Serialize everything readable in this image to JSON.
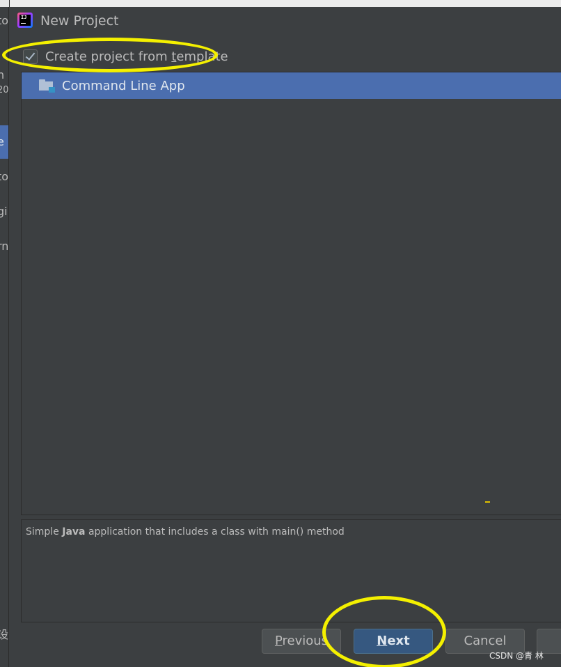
{
  "background_window": {
    "fragments": [
      "to",
      "n",
      "20",
      "e",
      "to",
      "gi",
      "rn",
      "设"
    ]
  },
  "dialog": {
    "title": "New Project",
    "app_icon": "intellij-idea-icon",
    "template_checkbox": {
      "label_pre": "Create project from ",
      "label_mnemonic": "t",
      "label_post": "emplate",
      "checked": true
    },
    "templates": [
      {
        "label": "Command Line App",
        "icon": "folder-icon",
        "selected": true
      }
    ],
    "description": {
      "pre": "Simple ",
      "bold": "Java",
      "post": " application that includes a class with main() method"
    },
    "buttons": {
      "previous": {
        "mnemonic": "P",
        "rest": "revious"
      },
      "next": {
        "mnemonic": "N",
        "rest": "ext"
      },
      "cancel": "Cancel"
    }
  },
  "watermark": "CSDN @青  林",
  "colors": {
    "dialog_bg": "#3c3f41",
    "selection": "#4b6eaf",
    "default_button": "#365880",
    "annotation": "#f4f000"
  }
}
